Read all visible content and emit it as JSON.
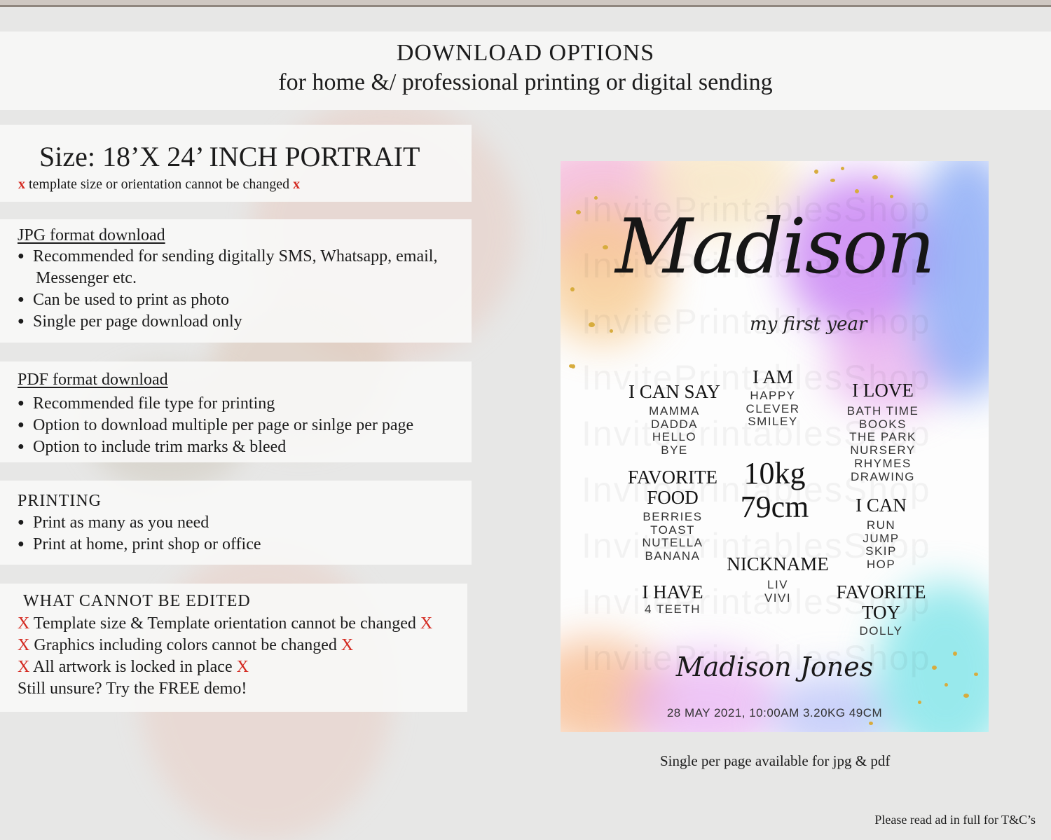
{
  "header": {
    "title": "DOWNLOAD OPTIONS",
    "subtitle": "for home &/ professional printing or digital sending"
  },
  "size_panel": {
    "title": "Size: 18’X 24’ INCH PORTRAIT",
    "mark": "x",
    "note": "template size or orientation cannot be changed"
  },
  "jpg_panel": {
    "title": "JPG format download",
    "bullets": [
      "Recommended for sending digitally SMS, Whatsapp, email,",
      "Can be used to print as photo",
      "Single per page download only"
    ],
    "continuation": "Messenger etc."
  },
  "pdf_panel": {
    "title": "PDF format download",
    "bullets": [
      "Recommended file type for printing",
      "Option to download multiple per page or sinlge per page",
      "Option to include trim marks & bleed"
    ]
  },
  "printing_panel": {
    "title": "PRINTING",
    "bullets": [
      "Print as many as you need",
      "Print at home, print shop or office"
    ]
  },
  "edit_panel": {
    "title": "WHAT CANNOT BE EDITED",
    "mark": "X",
    "lines": [
      "Template size & Template orientation cannot be changed",
      "Graphics including colors cannot be changed",
      "All artwork is locked in place"
    ],
    "closing": "Still unsure? Try the FREE demo!"
  },
  "poster": {
    "name": "Madison",
    "subtitle": "my first year",
    "watermark": "InvitePrintablesShop",
    "i_can_say": {
      "heading": "I CAN SAY",
      "items": [
        "MAMMA",
        "DADDA",
        "HELLO",
        "BYE"
      ]
    },
    "i_am": {
      "heading": "I AM",
      "items": [
        "HAPPY",
        "CLEVER",
        "SMILEY"
      ]
    },
    "i_love": {
      "heading": "I LOVE",
      "items": [
        "BATH TIME",
        "BOOKS",
        "THE PARK",
        "NURSERY",
        "RHYMES",
        "DRAWING"
      ]
    },
    "favorite_food": {
      "heading1": "FAVORITE",
      "heading2": "FOOD",
      "items": [
        "BERRIES",
        "TOAST",
        "NUTELLA",
        "BANANA"
      ]
    },
    "weight": "10kg",
    "height": "79cm",
    "i_can": {
      "heading": "I CAN",
      "items": [
        "RUN",
        "JUMP",
        "SKIP",
        "HOP"
      ]
    },
    "nickname": {
      "heading": "NICKNAME",
      "items": [
        "LIV",
        "VIVI"
      ]
    },
    "i_have": {
      "heading": "I HAVE",
      "items": [
        "4 TEETH"
      ]
    },
    "favorite_toy": {
      "heading1": "FAVORITE",
      "heading2": "TOY",
      "items": [
        "DOLLY"
      ]
    },
    "signature": "Madison Jones",
    "birth_details": "28 MAY 2021, 10:00AM 3.20KG 49CM"
  },
  "caption": "Single per page available for jpg & pdf",
  "footer_note": "Please read ad in full for T&C’s"
}
